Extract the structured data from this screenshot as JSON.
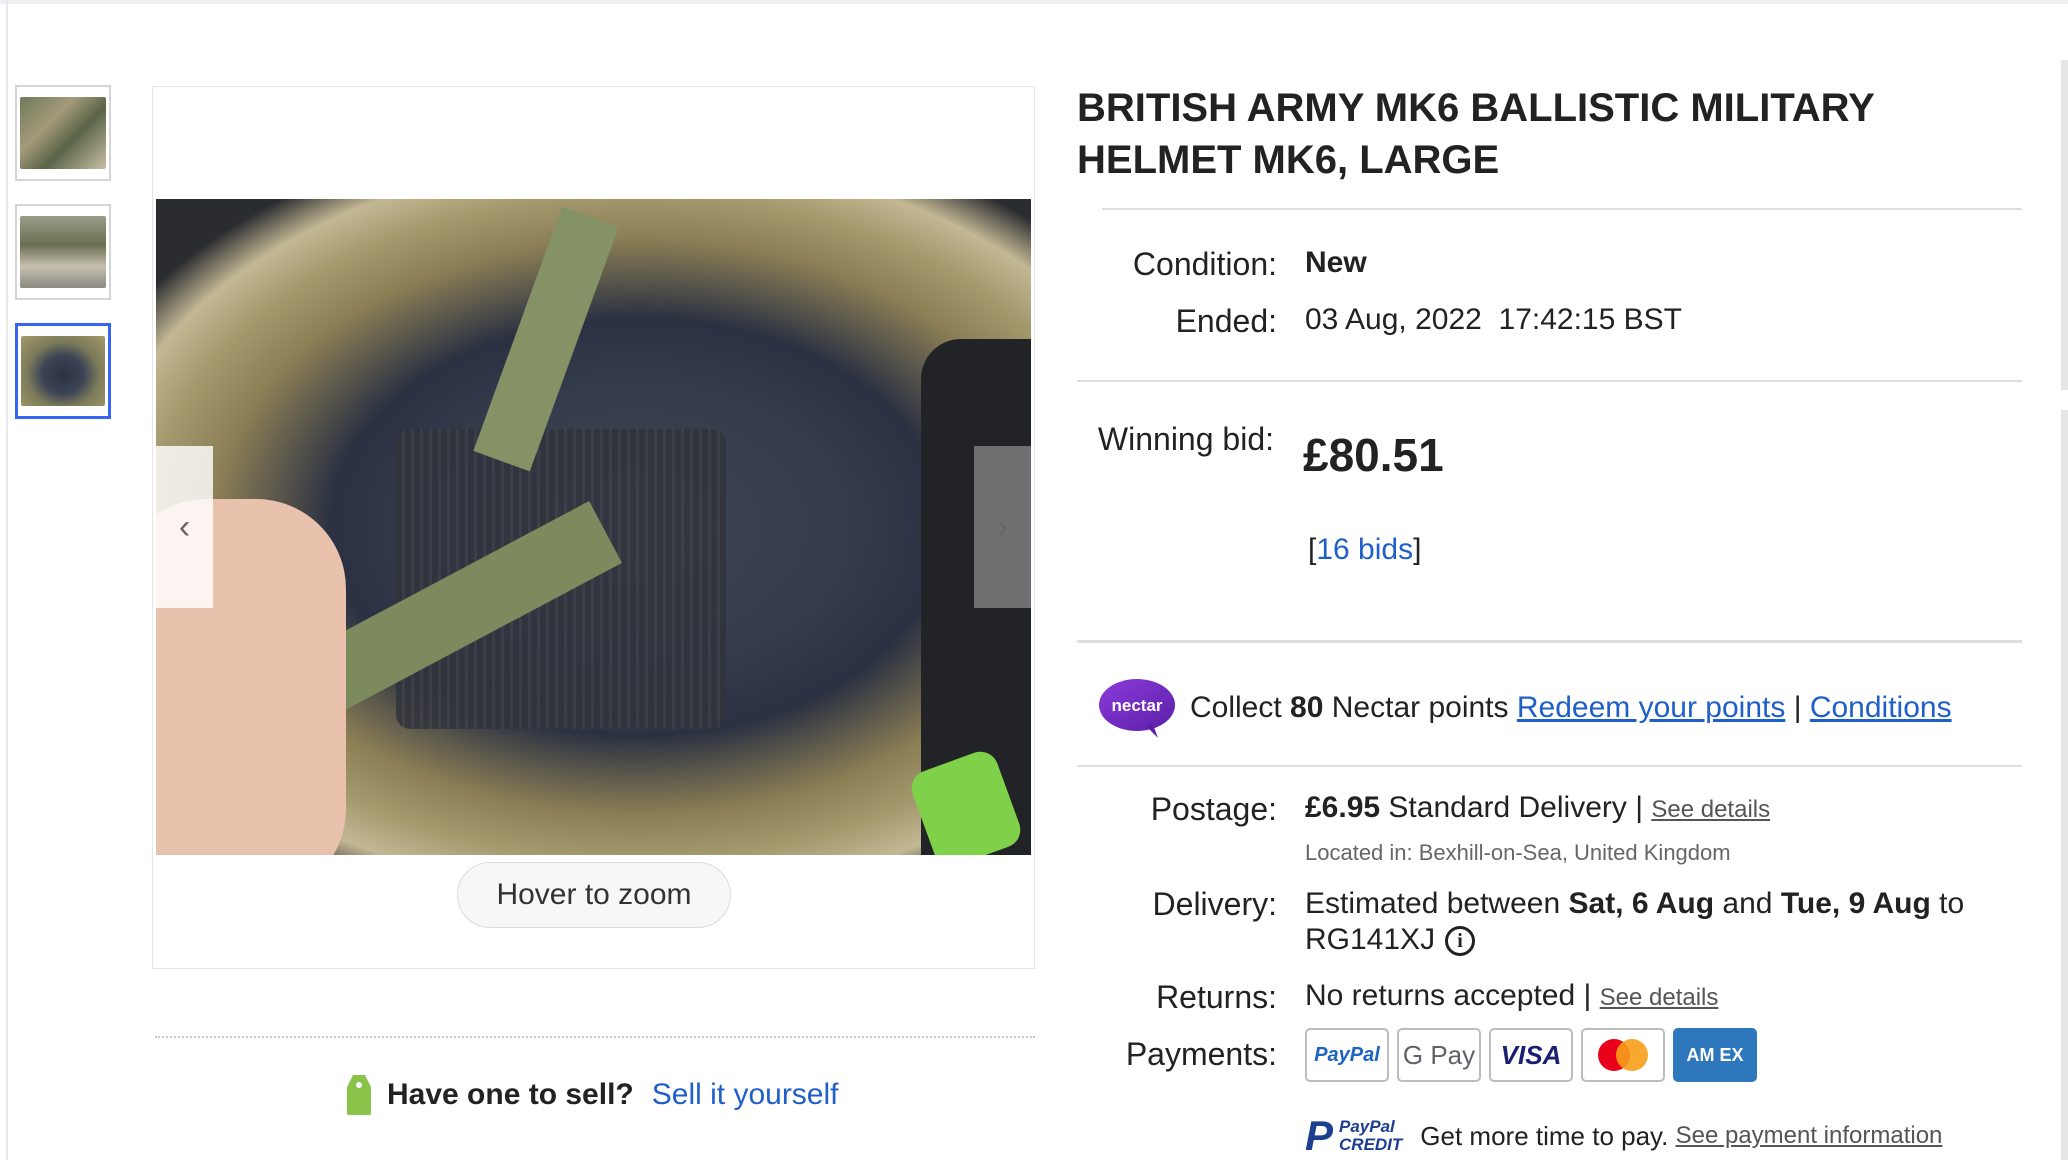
{
  "gallery": {
    "thumbnails": [
      "thumbnail-1",
      "thumbnail-2",
      "thumbnail-3"
    ],
    "selected_index": 2,
    "zoom_label": "Hover to zoom",
    "prev_icon": "chevron-left-icon",
    "next_icon": "chevron-right-icon"
  },
  "sell": {
    "question": "Have one to sell?",
    "link": "Sell it yourself"
  },
  "listing": {
    "title": "BRITISH ARMY MK6 BALLISTIC MILITARY HELMET MK6, LARGE",
    "condition_label": "Condition:",
    "condition_value": "New",
    "ended_label": "Ended:",
    "ended_date": "03 Aug, 2022",
    "ended_time": "17:42:15 BST",
    "winning_bid_label": "Winning bid:",
    "winning_bid": "£80.51",
    "bids_open": "[",
    "bids_link": "16 bids",
    "bids_close": "]"
  },
  "nectar": {
    "logo_text": "nectar",
    "collect_prefix": "Collect",
    "points": "80",
    "collect_suffix": "Nectar points",
    "redeem_link": "Redeem your points",
    "separator": "|",
    "conditions_link": "Conditions"
  },
  "shipping": {
    "postage_label": "Postage:",
    "postage_price": "£6.95",
    "postage_service": "Standard Delivery",
    "postage_sep": "|",
    "postage_link": "See details",
    "location": "Located in: Bexhill-on-Sea, United Kingdom",
    "delivery_label": "Delivery:",
    "delivery_prefix": "Estimated between",
    "delivery_start": "Sat, 6 Aug",
    "delivery_and": "and",
    "delivery_end": "Tue, 9 Aug",
    "delivery_to": "to",
    "delivery_postcode": "RG141XJ",
    "info_icon": "i",
    "returns_label": "Returns:",
    "returns_value": "No returns accepted",
    "returns_sep": "|",
    "returns_link": "See details",
    "payments_label": "Payments:"
  },
  "payments": {
    "methods": [
      "PayPal",
      "G Pay",
      "VISA",
      "",
      "AM EX"
    ],
    "paypal_credit_p": "P",
    "paypal_credit_line1": "PayPal",
    "paypal_credit_line2": "CREDIT",
    "credit_text": "Get more time to pay.",
    "credit_link": "See payment information"
  },
  "colors": {
    "link": "#1f5fc9",
    "selected_border": "#3665f3",
    "nectar": "#7b2ccf"
  }
}
